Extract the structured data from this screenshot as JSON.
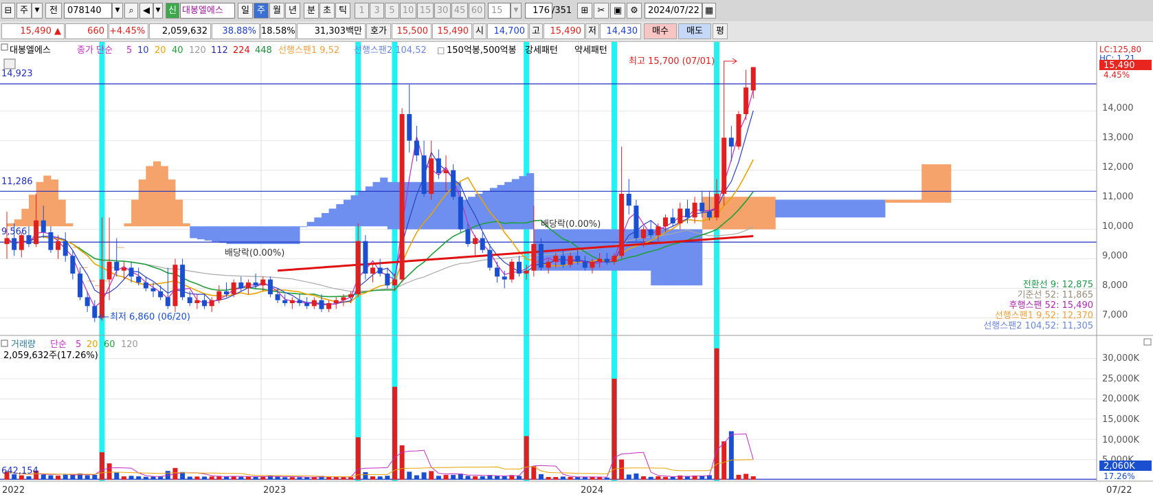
{
  "toolbar": {
    "type_label": "주",
    "prev_label": "전",
    "code": "078140",
    "new_badge": "신",
    "stock_name": "대봉엘에스",
    "periods": [
      "일",
      "주",
      "월",
      "년",
      "분",
      "초",
      "틱"
    ],
    "selected_period": "주",
    "intervals": [
      "1",
      "3",
      "5",
      "10",
      "15",
      "30",
      "45",
      "60"
    ],
    "interval_value": "15",
    "count_value": "176",
    "count_total": "/351",
    "date": "2024/07/22"
  },
  "quote": {
    "price": "15,490",
    "arrow": "▲",
    "change": "660",
    "change_pct": "+4.45%",
    "volume": "2,059,632",
    "ratio1": "38.88%",
    "ratio2": "18.58%",
    "amount": "31,303백만",
    "ask_label": "호가",
    "ask": "15,500",
    "bid": "15,490",
    "open_label": "시",
    "open": "14,700",
    "high_label": "고",
    "high": "15,490",
    "low_label": "저",
    "low": "14,430",
    "buy_label": "매수",
    "sell_label": "매도",
    "eval_label": "평"
  },
  "price_panel": {
    "name": "대봉엘에스",
    "legend_ma_label": "종가 단순",
    "ma_periods": [
      "5",
      "10",
      "20",
      "40",
      "120",
      "112",
      "224",
      "448"
    ],
    "span1_label": "선행스팬1 9,52",
    "span2_label": "선행스팬2 104,52",
    "pattern_marker": "□",
    "pattern_label": "150억봉,500억봉",
    "strong_label": "강세패턴",
    "weak_label": "약세패턴",
    "hline_labels": [
      "14,923",
      "11,286",
      "9,566"
    ],
    "high_annotation": "최고 15,700 (07/01)",
    "low_annotation": "최저 6,860 (06/20)",
    "dividend_label": "배당락(0.00%)",
    "lc_label": "LC:125,80",
    "hc_label": "HC: 1.21",
    "price_tag": "15,490",
    "pct_tag": "4.45%",
    "ichimoku": [
      {
        "label": "전환선 9: 12,875",
        "color": "#1e9a4a"
      },
      {
        "label": "기준선 52: 11,865",
        "color": "#9a8a7a"
      },
      {
        "label": "후행스팬 52: 15,490",
        "color": "#b028b0"
      },
      {
        "label": "선행스팬1 9,52: 12,370",
        "color": "#f2a13a"
      },
      {
        "label": "선행스팬2 104,52: 11,305",
        "color": "#6b86e0"
      }
    ],
    "y_ticks": [
      "14,000",
      "13,000",
      "12,000",
      "11,000",
      "10,000",
      "9,000",
      "8,000",
      "7,000"
    ]
  },
  "volume_panel": {
    "title": "거래량",
    "ma_label": "단순",
    "ma_periods": [
      "5",
      "20",
      "60",
      "120"
    ],
    "volume_text": "2,059,632주(17.26%)",
    "hline_label": "642,154",
    "vol_tag": "2,060K",
    "vol_pct": "17.26%",
    "y_ticks": [
      "30,000K",
      "25,000K",
      "20,000K",
      "15,000K",
      "10,000K",
      "5,000K"
    ]
  },
  "x_axis": {
    "labels": [
      "2022",
      "2023",
      "2024"
    ],
    "last_date": "07/22"
  },
  "colors": {
    "up": "#e02020",
    "down": "#1a4fd0",
    "cyan_band": "#22f2f2",
    "cloud_bull": "#f5a36a",
    "cloud_bear": "#6f8ff0",
    "hline": "#1e2fc0"
  },
  "chart_data": {
    "type": "candlestick",
    "ylim": [
      6500,
      15900
    ],
    "volume_ylim": [
      0,
      34000
    ],
    "horizontal_lines": [
      14923,
      11286,
      9566
    ],
    "candles": [
      {
        "o": 9500,
        "h": 10600,
        "l": 9000,
        "c": 9700
      },
      {
        "o": 9700,
        "h": 10200,
        "l": 9100,
        "c": 9300
      },
      {
        "o": 9300,
        "h": 9900,
        "l": 9050,
        "c": 9800
      },
      {
        "o": 9800,
        "h": 10100,
        "l": 9400,
        "c": 9500
      },
      {
        "o": 9500,
        "h": 11200,
        "l": 9400,
        "c": 10300
      },
      {
        "o": 10300,
        "h": 10800,
        "l": 9700,
        "c": 9900
      },
      {
        "o": 9900,
        "h": 10100,
        "l": 9200,
        "c": 9300
      },
      {
        "o": 9300,
        "h": 9800,
        "l": 9000,
        "c": 9600
      },
      {
        "o": 9600,
        "h": 9900,
        "l": 8900,
        "c": 9100
      },
      {
        "o": 9100,
        "h": 9300,
        "l": 8300,
        "c": 8500
      },
      {
        "o": 8500,
        "h": 8700,
        "l": 7600,
        "c": 7700
      },
      {
        "o": 7700,
        "h": 7900,
        "l": 7200,
        "c": 7400
      },
      {
        "o": 7400,
        "h": 7600,
        "l": 6860,
        "c": 7000
      },
      {
        "o": 7000,
        "h": 10400,
        "l": 6900,
        "c": 8300
      },
      {
        "o": 8300,
        "h": 10400,
        "l": 7600,
        "c": 8900
      },
      {
        "o": 8900,
        "h": 9700,
        "l": 8400,
        "c": 8600
      },
      {
        "o": 8600,
        "h": 8900,
        "l": 8300,
        "c": 8700
      },
      {
        "o": 8700,
        "h": 8900,
        "l": 8200,
        "c": 8400
      },
      {
        "o": 8400,
        "h": 8700,
        "l": 8100,
        "c": 8200
      },
      {
        "o": 8200,
        "h": 8400,
        "l": 7900,
        "c": 8000
      },
      {
        "o": 8000,
        "h": 8200,
        "l": 7700,
        "c": 7900
      },
      {
        "o": 7900,
        "h": 8100,
        "l": 7600,
        "c": 7700
      },
      {
        "o": 7700,
        "h": 8700,
        "l": 7300,
        "c": 7400
      },
      {
        "o": 7400,
        "h": 9000,
        "l": 7200,
        "c": 8800
      },
      {
        "o": 8800,
        "h": 9000,
        "l": 7600,
        "c": 7700
      },
      {
        "o": 7700,
        "h": 7900,
        "l": 7400,
        "c": 7500
      },
      {
        "o": 7500,
        "h": 7800,
        "l": 7300,
        "c": 7600
      },
      {
        "o": 7600,
        "h": 7800,
        "l": 7300,
        "c": 7400
      },
      {
        "o": 7400,
        "h": 7700,
        "l": 7200,
        "c": 7600
      },
      {
        "o": 7600,
        "h": 8100,
        "l": 7500,
        "c": 7900
      },
      {
        "o": 7900,
        "h": 8200,
        "l": 7700,
        "c": 7800
      },
      {
        "o": 7800,
        "h": 8300,
        "l": 7700,
        "c": 8200
      },
      {
        "o": 8200,
        "h": 8400,
        "l": 7900,
        "c": 8000
      },
      {
        "o": 8000,
        "h": 8300,
        "l": 7800,
        "c": 8200
      },
      {
        "o": 8200,
        "h": 8500,
        "l": 8000,
        "c": 8100
      },
      {
        "o": 8100,
        "h": 8400,
        "l": 7900,
        "c": 8300
      },
      {
        "o": 8300,
        "h": 8400,
        "l": 7700,
        "c": 7800
      },
      {
        "o": 7800,
        "h": 8000,
        "l": 7500,
        "c": 7600
      },
      {
        "o": 7600,
        "h": 7800,
        "l": 7400,
        "c": 7500
      },
      {
        "o": 7500,
        "h": 7700,
        "l": 7300,
        "c": 7600
      },
      {
        "o": 7600,
        "h": 7800,
        "l": 7400,
        "c": 7500
      },
      {
        "o": 7500,
        "h": 7700,
        "l": 7300,
        "c": 7400
      },
      {
        "o": 7400,
        "h": 7700,
        "l": 7300,
        "c": 7600
      },
      {
        "o": 7600,
        "h": 7800,
        "l": 7200,
        "c": 7300
      },
      {
        "o": 7300,
        "h": 7600,
        "l": 7200,
        "c": 7500
      },
      {
        "o": 7500,
        "h": 7700,
        "l": 7300,
        "c": 7600
      },
      {
        "o": 7600,
        "h": 7800,
        "l": 7400,
        "c": 7700
      },
      {
        "o": 7700,
        "h": 7900,
        "l": 7500,
        "c": 7800
      },
      {
        "o": 7800,
        "h": 10200,
        "l": 7700,
        "c": 9600
      },
      {
        "o": 9600,
        "h": 9800,
        "l": 8300,
        "c": 8500
      },
      {
        "o": 8500,
        "h": 8800,
        "l": 8200,
        "c": 8700
      },
      {
        "o": 8700,
        "h": 9000,
        "l": 8400,
        "c": 8500
      },
      {
        "o": 8500,
        "h": 8700,
        "l": 8000,
        "c": 8100
      },
      {
        "o": 8100,
        "h": 8500,
        "l": 7900,
        "c": 8300
      },
      {
        "o": 8300,
        "h": 14100,
        "l": 8200,
        "c": 13900
      },
      {
        "o": 13900,
        "h": 14900,
        "l": 12600,
        "c": 13000
      },
      {
        "o": 13000,
        "h": 13500,
        "l": 12300,
        "c": 12500
      },
      {
        "o": 12500,
        "h": 13000,
        "l": 11100,
        "c": 11200
      },
      {
        "o": 11200,
        "h": 13000,
        "l": 11000,
        "c": 12400
      },
      {
        "o": 12400,
        "h": 12700,
        "l": 11700,
        "c": 11900
      },
      {
        "o": 11900,
        "h": 12500,
        "l": 11300,
        "c": 12000
      },
      {
        "o": 12000,
        "h": 12200,
        "l": 11000,
        "c": 11100
      },
      {
        "o": 11100,
        "h": 11300,
        "l": 9900,
        "c": 10000
      },
      {
        "o": 10000,
        "h": 10200,
        "l": 9400,
        "c": 9500
      },
      {
        "o": 9500,
        "h": 9800,
        "l": 9100,
        "c": 9700
      },
      {
        "o": 9700,
        "h": 9900,
        "l": 9200,
        "c": 9300
      },
      {
        "o": 9300,
        "h": 9500,
        "l": 8600,
        "c": 8700
      },
      {
        "o": 8700,
        "h": 8900,
        "l": 8200,
        "c": 8400
      },
      {
        "o": 8400,
        "h": 8600,
        "l": 8000,
        "c": 8300
      },
      {
        "o": 8300,
        "h": 9000,
        "l": 8200,
        "c": 8900
      },
      {
        "o": 8900,
        "h": 9100,
        "l": 8400,
        "c": 8500
      },
      {
        "o": 8500,
        "h": 8800,
        "l": 8300,
        "c": 8600
      },
      {
        "o": 8600,
        "h": 10800,
        "l": 8400,
        "c": 9500
      },
      {
        "o": 9500,
        "h": 9700,
        "l": 8600,
        "c": 8700
      },
      {
        "o": 8700,
        "h": 9000,
        "l": 8500,
        "c": 8900
      },
      {
        "o": 8900,
        "h": 9200,
        "l": 8700,
        "c": 9100
      },
      {
        "o": 9100,
        "h": 9300,
        "l": 8700,
        "c": 8800
      },
      {
        "o": 8800,
        "h": 9200,
        "l": 8700,
        "c": 9100
      },
      {
        "o": 9100,
        "h": 9300,
        "l": 8800,
        "c": 8900
      },
      {
        "o": 8900,
        "h": 9100,
        "l": 8600,
        "c": 8700
      },
      {
        "o": 8700,
        "h": 9000,
        "l": 8500,
        "c": 8900
      },
      {
        "o": 8900,
        "h": 9200,
        "l": 8700,
        "c": 9000
      },
      {
        "o": 9000,
        "h": 9200,
        "l": 8800,
        "c": 8900
      },
      {
        "o": 8900,
        "h": 9200,
        "l": 8800,
        "c": 9100
      },
      {
        "o": 9100,
        "h": 12800,
        "l": 9000,
        "c": 11200
      },
      {
        "o": 11200,
        "h": 11700,
        "l": 10500,
        "c": 10800
      },
      {
        "o": 10800,
        "h": 11000,
        "l": 9600,
        "c": 9700
      },
      {
        "o": 9700,
        "h": 10100,
        "l": 9400,
        "c": 10000
      },
      {
        "o": 10000,
        "h": 10300,
        "l": 9700,
        "c": 9800
      },
      {
        "o": 9800,
        "h": 10200,
        "l": 9500,
        "c": 10100
      },
      {
        "o": 10100,
        "h": 10500,
        "l": 9900,
        "c": 10400
      },
      {
        "o": 10400,
        "h": 10700,
        "l": 10100,
        "c": 10200
      },
      {
        "o": 10200,
        "h": 10900,
        "l": 10000,
        "c": 10700
      },
      {
        "o": 10700,
        "h": 11000,
        "l": 10200,
        "c": 10400
      },
      {
        "o": 10400,
        "h": 11100,
        "l": 10200,
        "c": 10900
      },
      {
        "o": 10900,
        "h": 11300,
        "l": 10400,
        "c": 10600
      },
      {
        "o": 10600,
        "h": 11300,
        "l": 10300,
        "c": 10400
      },
      {
        "o": 10400,
        "h": 11700,
        "l": 10300,
        "c": 11200
      },
      {
        "o": 11200,
        "h": 15700,
        "l": 10800,
        "c": 13100
      },
      {
        "o": 13100,
        "h": 13500,
        "l": 12300,
        "c": 12800
      },
      {
        "o": 12800,
        "h": 14000,
        "l": 12700,
        "c": 13900
      },
      {
        "o": 13900,
        "h": 15400,
        "l": 13700,
        "c": 14800
      },
      {
        "o": 14700,
        "h": 15490,
        "l": 14430,
        "c": 15490
      }
    ],
    "x_labels": [
      "2022",
      "2023",
      "2024",
      "07/22"
    ],
    "volume_labels": [
      "30,000K",
      "25,000K",
      "20,000K",
      "15,000K",
      "10,000K",
      "5,000K"
    ]
  }
}
